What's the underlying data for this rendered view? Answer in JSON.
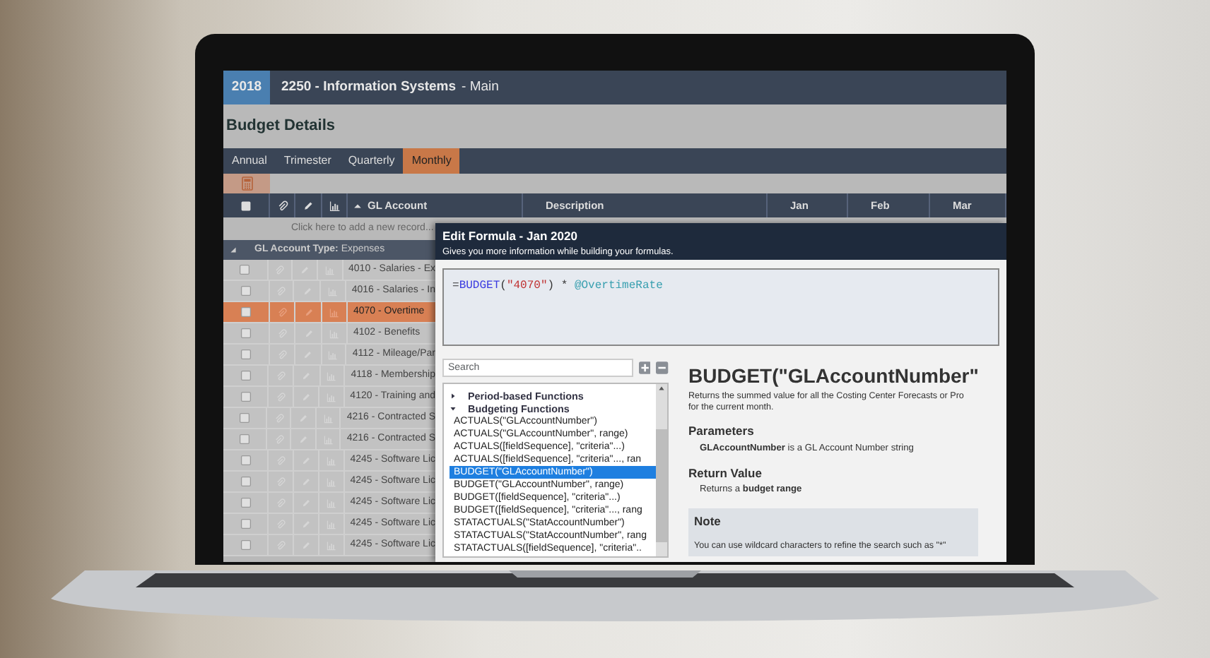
{
  "header": {
    "year": "2018",
    "title": "2250 - Information Systems",
    "subtitle": "- Main"
  },
  "page_title": "Budget Details",
  "tabs": [
    {
      "label": "Annual",
      "selected": false
    },
    {
      "label": "Trimester",
      "selected": false
    },
    {
      "label": "Quarterly",
      "selected": false
    },
    {
      "label": "Monthly",
      "selected": true
    }
  ],
  "columns": [
    "GL Account",
    "Description",
    "Jan",
    "Feb",
    "Mar"
  ],
  "add_record": "Click here to add a new record...",
  "group": {
    "label": "GL Account Type:",
    "value": "Expenses",
    "expanded": true
  },
  "rows": [
    {
      "account": "4010 - Salaries - Ex",
      "selected": false
    },
    {
      "account": "4016 - Salaries - In",
      "selected": false
    },
    {
      "account": "4070 - Overtime",
      "selected": true
    },
    {
      "account": "4102 - Benefits",
      "selected": false
    },
    {
      "account": "4112 - Mileage/Par",
      "selected": false
    },
    {
      "account": "4118 - Membership",
      "selected": false
    },
    {
      "account": "4120 - Training and",
      "selected": false
    },
    {
      "account": "4216 - Contracted S",
      "selected": false
    },
    {
      "account": "4216 - Contracted S",
      "selected": false
    },
    {
      "account": "4245 - Software Lic",
      "selected": false
    },
    {
      "account": "4245 - Software Lic",
      "selected": false
    },
    {
      "account": "4245 - Software Lic",
      "selected": false
    },
    {
      "account": "4245 - Software Lic",
      "selected": false
    },
    {
      "account": "4245 - Software Lic",
      "selected": false
    }
  ],
  "dialog": {
    "title": "Edit Formula - Jan 2020",
    "subtitle": "Gives you more information while building your formulas.",
    "formula": [
      {
        "kind": "plain",
        "text": "="
      },
      {
        "kind": "function",
        "text": "BUDGET"
      },
      {
        "kind": "plain",
        "text": "("
      },
      {
        "kind": "string",
        "text": "\"4070\""
      },
      {
        "kind": "plain",
        "text": ") * "
      },
      {
        "kind": "variable",
        "text": "@OvertimeRate"
      }
    ],
    "search": {
      "placeholder": "Search"
    },
    "tree": [
      {
        "label": "Period-based Functions",
        "expanded": false
      },
      {
        "label": "Budgeting Functions",
        "expanded": true,
        "children": [
          {
            "label": "ACTUALS(\"GLAccountNumber\")",
            "selected": false
          },
          {
            "label": "ACTUALS(\"GLAccountNumber\", range)",
            "selected": false
          },
          {
            "label": "ACTUALS([fieldSequence], \"criteria\"...)",
            "selected": false
          },
          {
            "label": "ACTUALS([fieldSequence], \"criteria\"..., ran",
            "selected": false
          },
          {
            "label": "BUDGET(\"GLAccountNumber\")",
            "selected": true
          },
          {
            "label": "BUDGET(\"GLAccountNumber\", range)",
            "selected": false
          },
          {
            "label": "BUDGET([fieldSequence], \"criteria\"...)",
            "selected": false
          },
          {
            "label": "BUDGET([fieldSequence], \"criteria\"..., rang",
            "selected": false
          },
          {
            "label": "STATACTUALS(\"StatAccountNumber\")",
            "selected": false
          },
          {
            "label": "STATACTUALS(\"StatAccountNumber\", rang",
            "selected": false
          },
          {
            "label": "STATACTUALS([fieldSequence], \"criteria\"..",
            "selected": false
          }
        ]
      }
    ],
    "help": {
      "title": "BUDGET(\"GLAccountNumber\"",
      "description": [
        "Returns the summed value for all the Costing Center Forecasts or Pro",
        "for the current month."
      ],
      "sections": [
        {
          "heading": "Parameters",
          "text": "**GLAccountNumber** is a GL Account Number string"
        },
        {
          "heading": "Return Value",
          "text": "Returns a **budget range**"
        }
      ],
      "note": {
        "heading": "Note",
        "text": "You can use wildcard characters to refine the search such as \"*\""
      }
    }
  }
}
